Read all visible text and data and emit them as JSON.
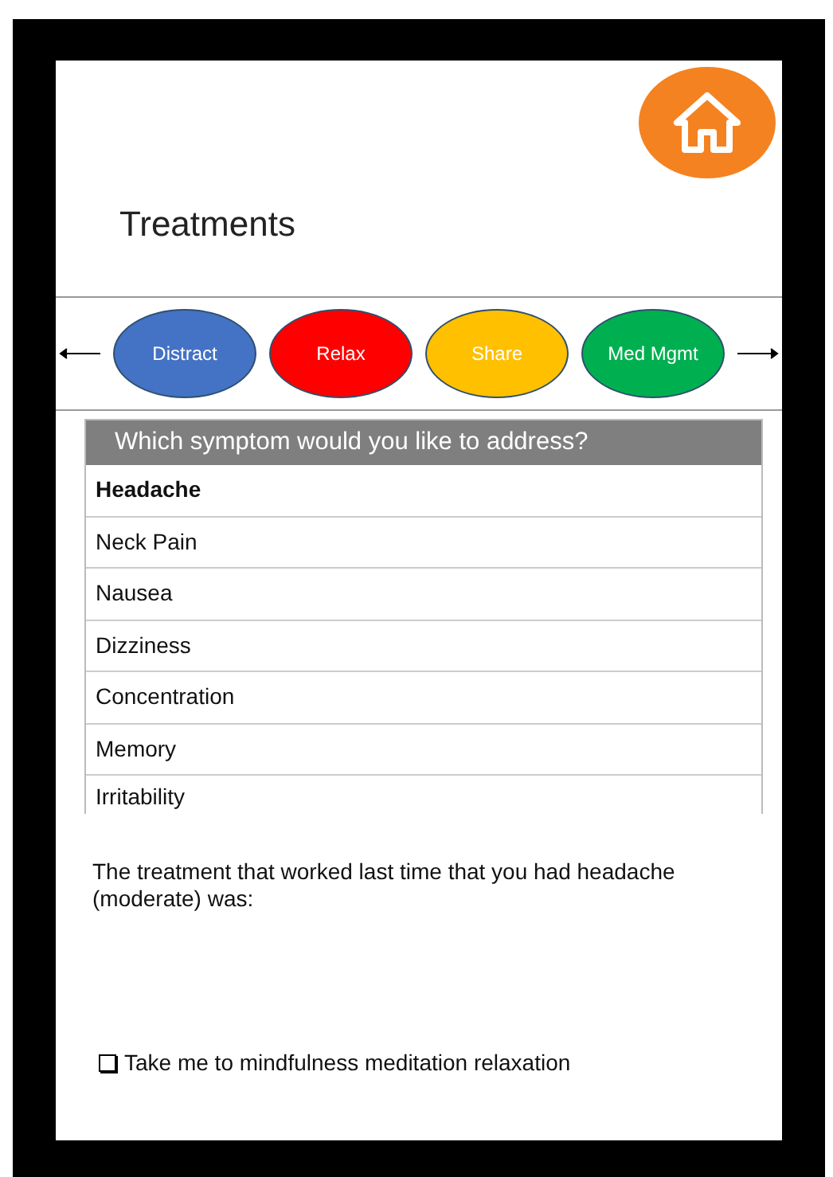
{
  "header": {
    "title": "Treatments"
  },
  "treatments": [
    {
      "label": "Distract",
      "color": "#4472c4"
    },
    {
      "label": "Relax",
      "color": "#ff0000"
    },
    {
      "label": "Share",
      "color": "#ffc000"
    },
    {
      "label": "Med Mgmt",
      "color": "#00b050"
    }
  ],
  "symptoms": {
    "heading": "Which symptom would you like to address?",
    "items": [
      {
        "label": "Headache",
        "selected": true
      },
      {
        "label": "Neck Pain",
        "selected": false
      },
      {
        "label": "Nausea",
        "selected": false
      },
      {
        "label": "Dizziness",
        "selected": false
      },
      {
        "label": "Concentration",
        "selected": false
      },
      {
        "label": "Memory",
        "selected": false
      },
      {
        "label": "Irritability",
        "selected": false
      }
    ]
  },
  "message": "The treatment that worked last time that you had headache (moderate) was:",
  "option": {
    "label": "Take me to mindfulness meditation relaxation",
    "checked": false
  }
}
